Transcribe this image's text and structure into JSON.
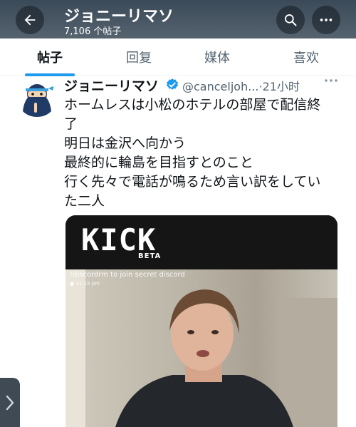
{
  "header": {
    "title": "ジョニーリマソ",
    "post_count": "7,106 个帖子",
    "back_icon": "arrow-left-icon",
    "search_icon": "search-icon",
    "more_icon": "more-horizontal-icon"
  },
  "tabs": [
    {
      "label": "帖子",
      "active": true
    },
    {
      "label": "回复",
      "active": false
    },
    {
      "label": "媒体",
      "active": false
    },
    {
      "label": "喜欢",
      "active": false
    }
  ],
  "post": {
    "author_name": "ジョニーリマソ",
    "verified_icon": "verified-badge-icon",
    "handle": "@canceljoh...",
    "separator": "·",
    "time": "21小时",
    "more_icon": "more-dots-icon",
    "text_lines": [
      "ホームレスは小松のホテルの部屋で配信終",
      "了",
      "明日は金沢へ向かう",
      "最終的に輪島を目指すとのこと",
      "行く先々で電話が鳴るため言い訳をしてい",
      "た二人"
    ],
    "media": {
      "logo_text": "KICK",
      "logo_sub": "BETA",
      "overlay_text": "!discordrm to join secret discord",
      "overlay_time": "● 11:15 pm"
    }
  },
  "colors": {
    "accent": "#1d9bf0",
    "header_bg": "#4a5866",
    "text_primary": "#0f1419",
    "text_secondary": "#536471"
  }
}
